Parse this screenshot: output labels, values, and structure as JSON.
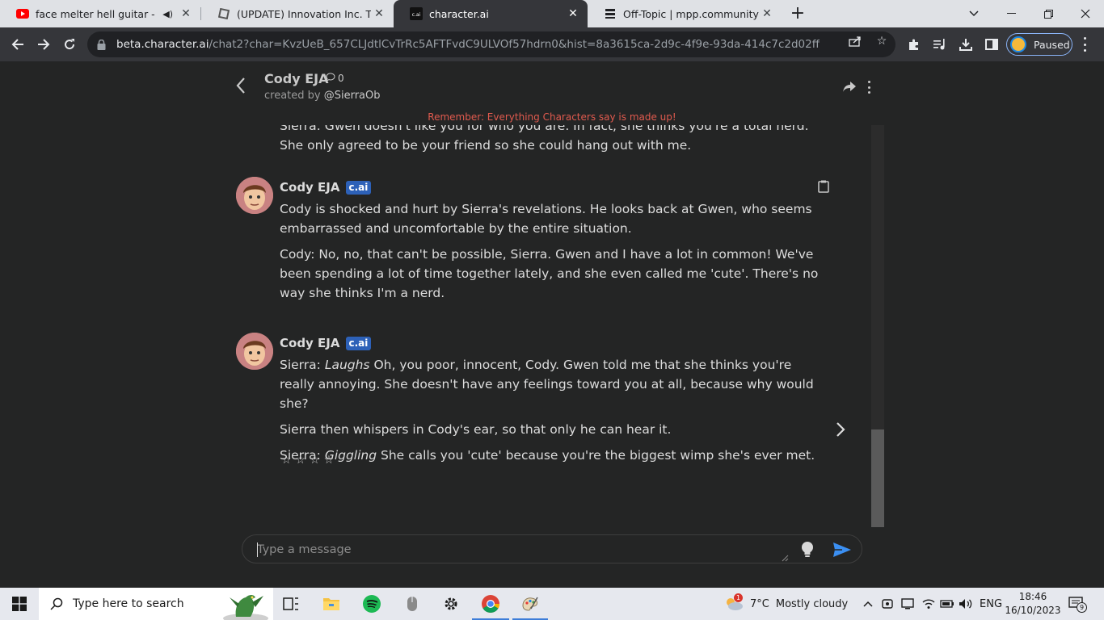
{
  "browser": {
    "tabs": [
      {
        "title": "face melter hell guitar - YouTube",
        "icon": "youtube-icon"
      },
      {
        "title": "(UPDATE) Innovation Inc. Thermal",
        "icon": "roblox-icon"
      },
      {
        "title": "character.ai",
        "icon": "cai-icon"
      },
      {
        "title": "Off-Topic | mpp.community",
        "icon": "forum-icon"
      }
    ],
    "url_host": "beta.character.ai",
    "url_path": "/chat2?char=KvzUeB_657CLJdtlCvTrRc5AFTFvdC9ULVOf57hdrn0&hist=8a3615ca-2d9c-4f9e-93da-414c7c2d02ff",
    "profile_label": "Paused"
  },
  "chat": {
    "character_name": "Cody EJA",
    "message_count": "0",
    "created_by_prefix": "created by ",
    "creator": "@SierraOb",
    "warning": "Remember: Everything Characters say is made up!",
    "partial_message": "Sierra: Gwen doesn't like you for who you are. In fact, she thinks you're a total nerd. She only agreed to be your friend so she could hang out with me.",
    "badge": "c.ai",
    "messages": [
      {
        "author": "Cody EJA",
        "paragraphs": [
          "Cody is shocked and hurt by Sierra's revelations. He looks back at Gwen, who seems embarrassed and uncomfortable by the entire situation.",
          "Cody: No, no, that can't be possible, Sierra. Gwen and I have a lot in common! We've been spending a lot of time together lately, and she even called me 'cute'. There's no way she thinks I'm a nerd."
        ]
      },
      {
        "author": "Cody EJA",
        "p1_prefix": "Sierra: ",
        "p1_italic": "Laughs",
        "p1_rest": " Oh, you poor, innocent, Cody. Gwen told me that she thinks you're really annoying. She doesn't have any feelings toward you at all, because why would she?",
        "p2": "Sierra then whispers in Cody's ear, so that only he can hear it.",
        "p3_prefix": "Sierra: ",
        "p3_italic": "Giggling",
        "p3_rest": " She calls you 'cute' because you're the biggest wimp she's ever met.",
        "rating_stars": "☆☆☆☆"
      }
    ],
    "composer_placeholder": "Type a message"
  },
  "taskbar": {
    "search_placeholder": "Type here to search",
    "weather_temp": "7°C",
    "weather_desc": "Mostly cloudy",
    "weather_alert_count": "1",
    "language": "ENG",
    "time": "18:46",
    "date": "16/10/2023",
    "notification_count": "9"
  }
}
